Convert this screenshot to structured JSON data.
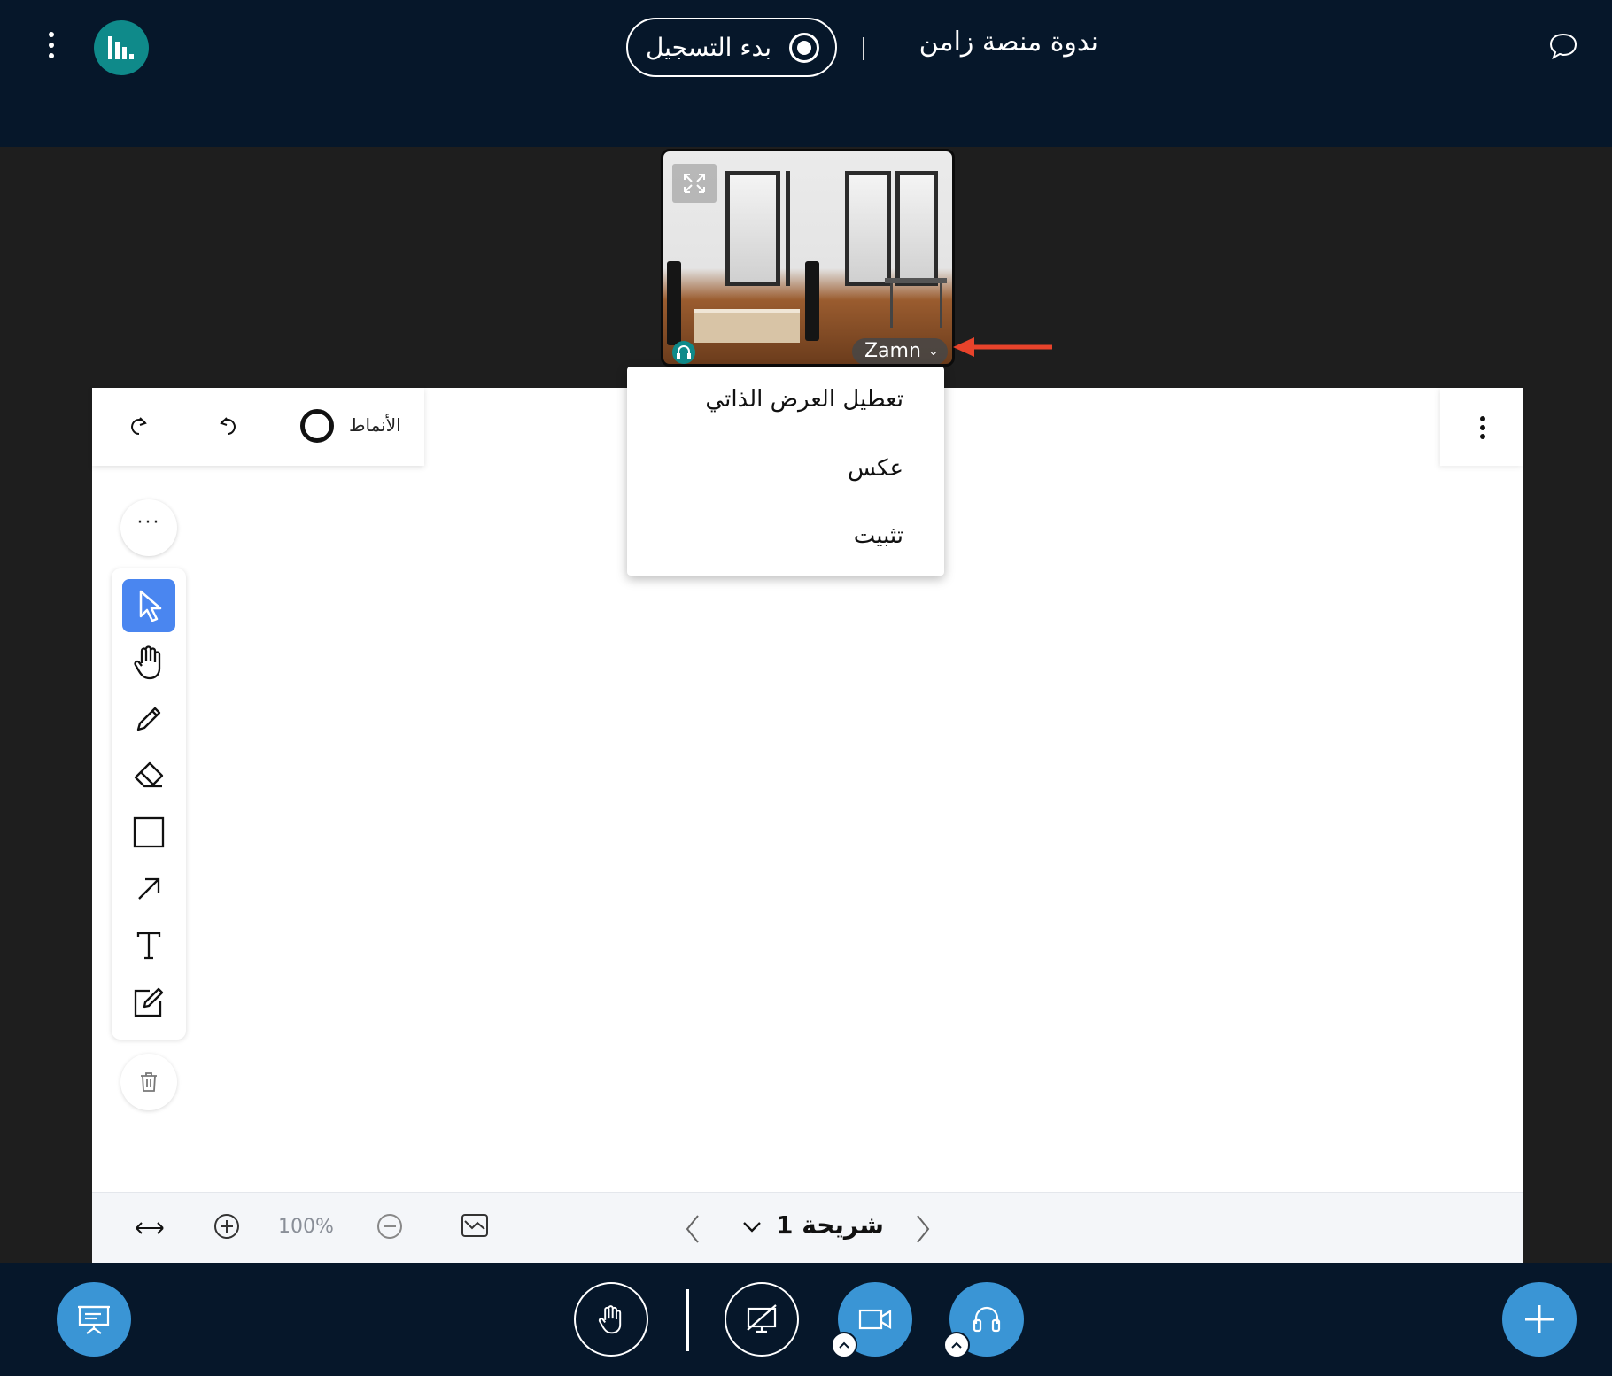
{
  "header": {
    "record_button_label": "بدء التسجيل",
    "meeting_title": "ندوة منصة زامن"
  },
  "webcam": {
    "user_name": "Zamn"
  },
  "webcam_menu": {
    "items": [
      {
        "label": "تعطيل العرض الذاتي"
      },
      {
        "label": "عكس"
      },
      {
        "label": "تثبيت"
      }
    ]
  },
  "whiteboard": {
    "styles_label": "الأنماط",
    "zoom_level": "100%",
    "slide_label": "شريحة 1",
    "tools": [
      "select-icon",
      "hand-pan-icon",
      "pencil-icon",
      "eraser-icon",
      "rectangle-icon",
      "arrow-icon",
      "text-icon",
      "note-icon"
    ],
    "active_tool": "select"
  },
  "colors": {
    "navy": "#06172a",
    "accent_blue": "#3a95d5",
    "active_tool_blue": "#4a86f0",
    "teal": "#0f8a8a",
    "annotation_red": "#e8432b"
  }
}
